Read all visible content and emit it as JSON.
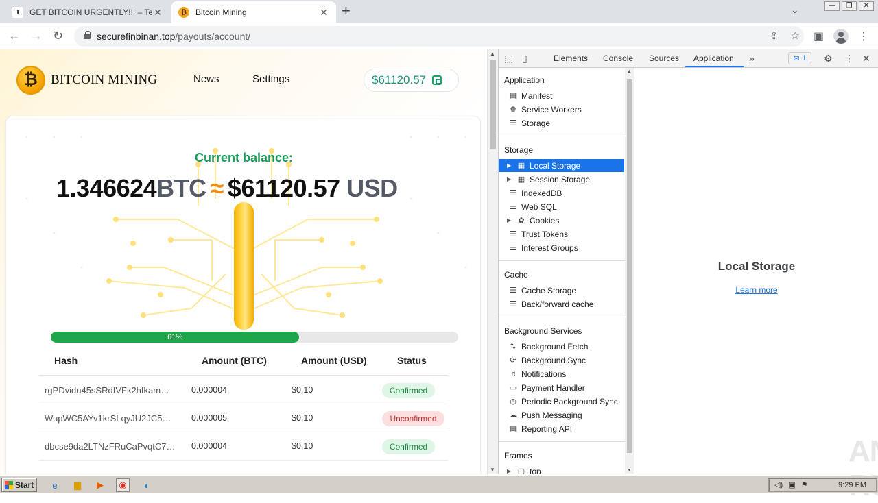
{
  "browser": {
    "tabs": [
      {
        "favicon": "T",
        "title": "GET BITCOIN URGENTLY!!! – Telegra"
      },
      {
        "favicon": "₿",
        "title": "Bitcoin Mining"
      }
    ],
    "url_host": "securefinbinan.top",
    "url_path": "/payouts/account/"
  },
  "site": {
    "brand": "BITCOIN MINING",
    "nav": [
      "News",
      "Settings"
    ],
    "header_balance": "$61120.57",
    "current_balance_label": "Current balance:",
    "btc_amount": "1.346624",
    "btc_unit": "BTC",
    "approx": "≈",
    "usd_amount": "$61120.57",
    "usd_unit": "USD",
    "progress_percent": 61,
    "progress_label": "61%",
    "table": {
      "columns": [
        "Hash",
        "Amount (BTC)",
        "Amount (USD)",
        "Status"
      ],
      "rows": [
        {
          "hash": "rgPDvidu45sSRdIVFk2hfkam…",
          "btc": "0.000004",
          "usd": "$0.10",
          "status": "Confirmed"
        },
        {
          "hash": "WupWC5AYv1krSLqyJU2JC5…",
          "btc": "0.000005",
          "usd": "$0.10",
          "status": "Unconfirmed"
        },
        {
          "hash": "dbcse9da2LTNzFRuCaPvqtC7…",
          "btc": "0.000004",
          "usd": "$0.10",
          "status": "Confirmed"
        }
      ]
    }
  },
  "devtools": {
    "tabs": [
      "Elements",
      "Console",
      "Sources",
      "Application"
    ],
    "active_tab": "Application",
    "issues_count": "1",
    "sidebar": {
      "application": {
        "title": "Application",
        "items": [
          "Manifest",
          "Service Workers",
          "Storage"
        ]
      },
      "storage": {
        "title": "Storage",
        "items": [
          "Local Storage",
          "Session Storage",
          "IndexedDB",
          "Web SQL",
          "Cookies",
          "Trust Tokens",
          "Interest Groups"
        ]
      },
      "cache": {
        "title": "Cache",
        "items": [
          "Cache Storage",
          "Back/forward cache"
        ]
      },
      "background": {
        "title": "Background Services",
        "items": [
          "Background Fetch",
          "Background Sync",
          "Notifications",
          "Payment Handler",
          "Periodic Background Sync",
          "Push Messaging",
          "Reporting API"
        ]
      },
      "frames": {
        "title": "Frames",
        "items": [
          "top"
        ]
      }
    },
    "main_title": "Local Storage",
    "learn_more": "Learn more",
    "watermark": "ANY RUN"
  },
  "taskbar": {
    "start": "Start",
    "time": "9:29 PM"
  },
  "colors": {
    "accent_green": "#1fa64a",
    "teal": "#1f8f7a",
    "devtools_blue": "#1a73e8"
  }
}
